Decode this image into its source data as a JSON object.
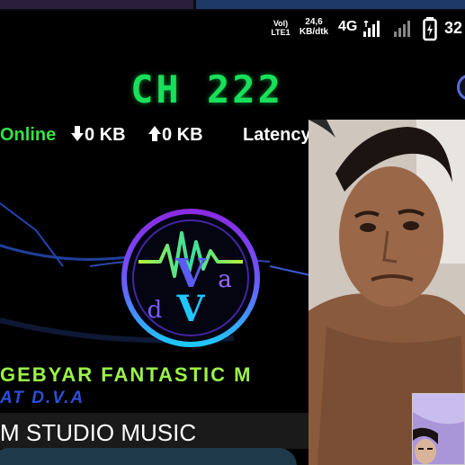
{
  "status_bar": {
    "volte": "Vol)",
    "volte_sub": "LTE1",
    "speed_value": "24,6",
    "speed_unit": "KB/dtk",
    "network": "4G",
    "time": "32"
  },
  "player": {
    "channel": "CH 222",
    "online_label": "Online",
    "download": "0 KB",
    "upload": "0 KB",
    "latency_label": "Latency"
  },
  "banner": {
    "title": "GEBYAR FANTASTIC M",
    "subtitle": "AT D.V.A"
  },
  "studio": {
    "label": "M STUDIO MUSIC"
  },
  "logo": {
    "letters": [
      "V",
      "d",
      "V",
      "a"
    ]
  },
  "colors": {
    "channel_green": "#18e05a",
    "online_green": "#35e045",
    "banner_green": "#9af24a",
    "subtitle_blue": "#2b4fd8",
    "logo_ring_start": "#8a2be2",
    "logo_ring_end": "#1ec8ff"
  },
  "icons": {
    "download": "arrow-down-icon",
    "upload": "arrow-up-icon",
    "signal": "signal-bars-icon",
    "battery": "battery-charging-icon"
  }
}
